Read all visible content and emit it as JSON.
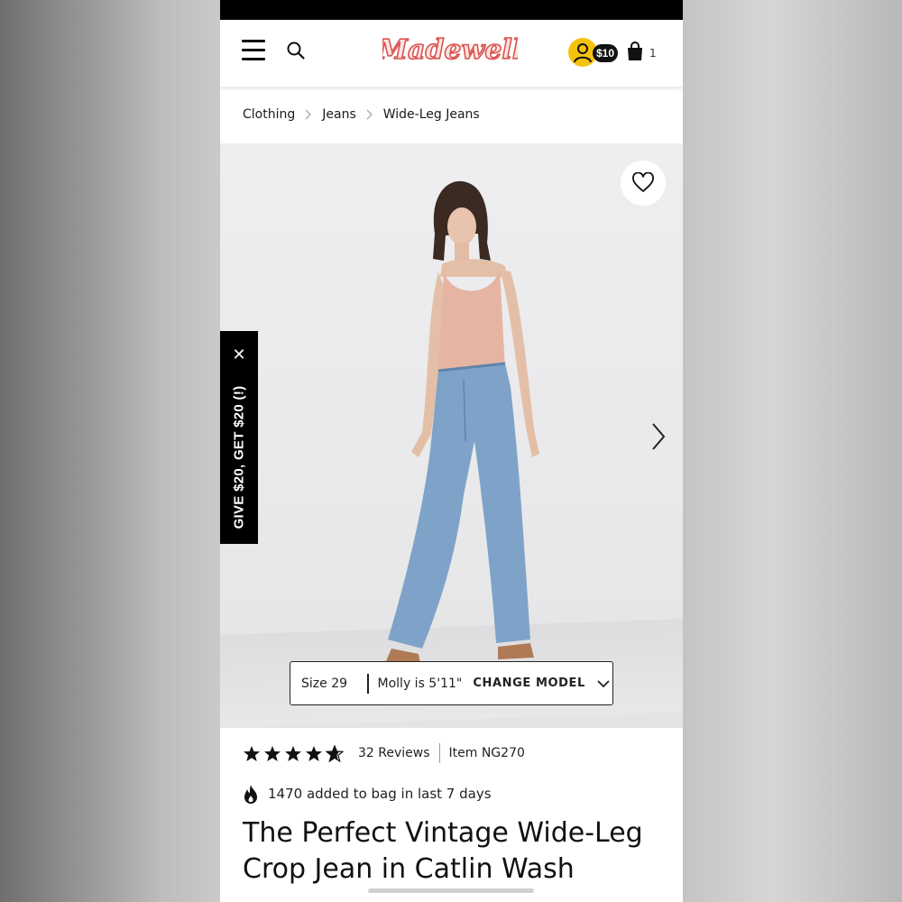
{
  "header": {
    "brand": "Madewell",
    "reward_badge": "$10",
    "bag_count": "1"
  },
  "breadcrumb": [
    "Clothing",
    "Jeans",
    "Wide-Leg Jeans"
  ],
  "promo_tab": {
    "text": "GIVE $20, GET $20 (!)",
    "close_glyph": "✕"
  },
  "size_bar": {
    "size": "Size 29",
    "model": "Molly is 5'11\"",
    "action": "CHANGE MODEL"
  },
  "product": {
    "rating": 4.5,
    "reviews": "32 Reviews",
    "item": "Item NG270",
    "popularity": "1470 added to bag in last 7 days",
    "title": "The Perfect Vintage Wide-Leg Crop Jean in Catlin Wash"
  },
  "colors": {
    "brand_pink": "#f0a7a0",
    "account_yellow": "#f4c20d",
    "top_pink": "#e6b4a2",
    "denim": "#7fa3c8"
  }
}
